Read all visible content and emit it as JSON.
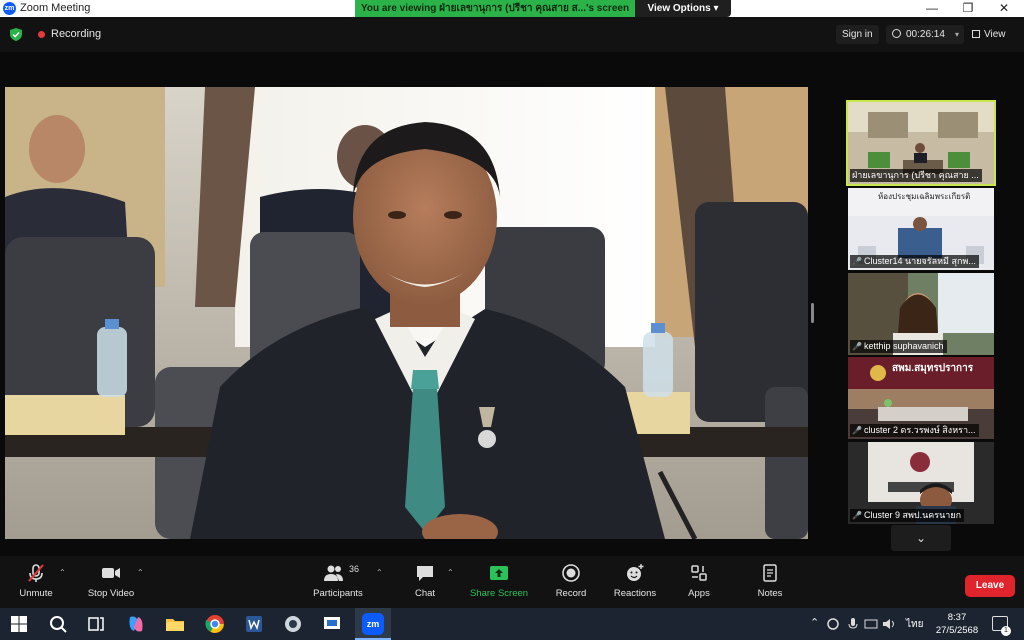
{
  "window": {
    "app_title": "Zoom Meeting",
    "logo_text": "zm",
    "minimize_glyph": "—",
    "maximize_glyph": "❐",
    "close_glyph": "✕"
  },
  "banner": {
    "viewing_text": "You are viewing ฝ่ายเลขานุการ (ปรีชา  คุณสาย  ส...'s screen",
    "view_options_label": "View Options ▾"
  },
  "status": {
    "recording_label": "Recording",
    "sign_in_label": "Sign in",
    "elapsed_time": "00:26:14",
    "view_label": "View"
  },
  "participants_panel": {
    "tiles": [
      {
        "name": "ฝ่ายเลขานุการ (ปรีชา  คุณสาย ...",
        "muted": false
      },
      {
        "name": "Cluster14 นายจรัลหมี สุกพ...",
        "muted": true,
        "overlay_text": "ห้องประชุมเฉลิมพระเกียรติ"
      },
      {
        "name": "ketthip suphavanich",
        "muted": true
      },
      {
        "name": "cluster 2 ดร.วรพงษ์ สิงหรา...",
        "muted": true,
        "overlay_text": "สพม.สมุทรปราการ"
      },
      {
        "name": "Cluster 9 สพป.นครนายก",
        "muted": true
      }
    ],
    "more_icon": "⌄"
  },
  "toolbar": {
    "unmute": "Unmute",
    "stop_video": "Stop Video",
    "participants": "Participants",
    "participants_count": "36",
    "chat": "Chat",
    "share_screen": "Share Screen",
    "record": "Record",
    "reactions": "Reactions",
    "apps": "Apps",
    "notes": "Notes",
    "leave": "Leave"
  },
  "taskbar": {
    "language": "ไทย",
    "time": "8:37",
    "date": "27/5/2568",
    "notification_count": "1",
    "zoom_icon_text": "zm"
  },
  "colors": {
    "accent_green": "#2bb34a",
    "leave_red": "#e0242c",
    "active_tile_border": "#c8e64a",
    "recording_red": "#e5393b"
  }
}
